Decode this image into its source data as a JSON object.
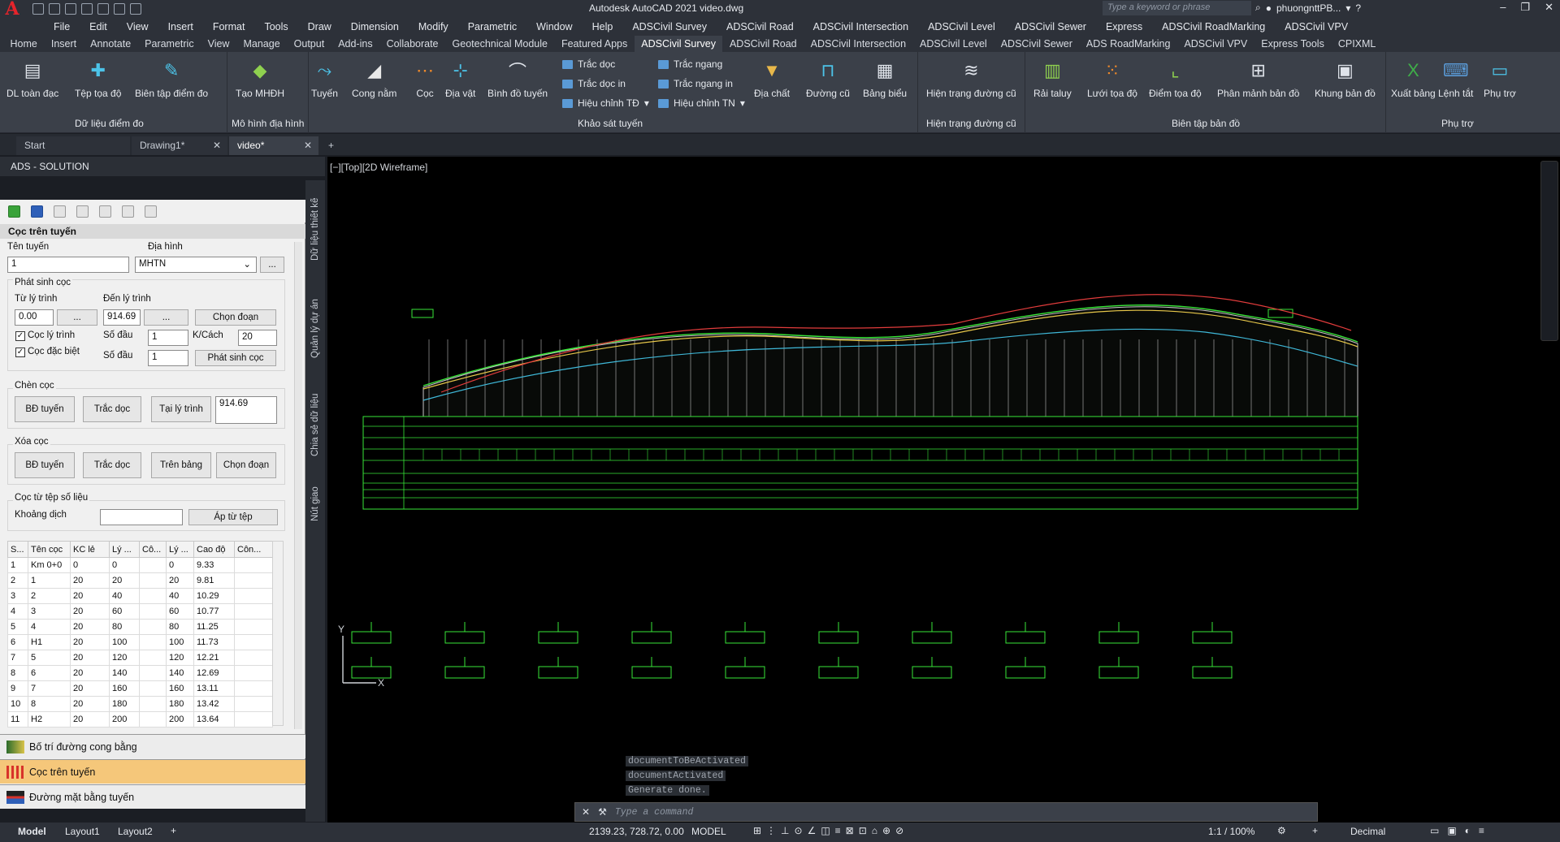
{
  "app": {
    "title": "Autodesk AutoCAD 2021  video.dwg",
    "search_placeholder": "Type a keyword or phrase",
    "user": "phuongnttPB...",
    "brand_color": "#e5242b"
  },
  "menubar": [
    "File",
    "Edit",
    "View",
    "Insert",
    "Format",
    "Tools",
    "Draw",
    "Dimension",
    "Modify",
    "Parametric",
    "Window",
    "Help",
    "ADSCivil Survey",
    "ADSCivil Road",
    "ADSCivil Intersection",
    "ADSCivil Level",
    "ADSCivil Sewer",
    "Express",
    "ADSCivil RoadMarking",
    "ADSCivil VPV"
  ],
  "ribbon_tabs": [
    "Home",
    "Insert",
    "Annotate",
    "Parametric",
    "View",
    "Manage",
    "Output",
    "Add-ins",
    "Collaborate",
    "Geotechnical Module",
    "Featured Apps",
    "ADSCivil Survey",
    "ADSCivil Road",
    "ADSCivil Intersection",
    "ADSCivil Level",
    "ADSCivil Sewer",
    "ADS RoadMarking",
    "ADSCivil VPV",
    "Express Tools",
    "CPIXML"
  ],
  "ribbon_active_tab": "ADSCivil Survey",
  "ribbon": {
    "panels": [
      "Dữ liệu điểm đo",
      "Mô hình địa hình",
      "Khảo sát tuyến",
      "Hiện trạng đường cũ",
      "Biên tập bản đồ",
      "Phụ trợ"
    ],
    "buttons": [
      "DL toàn đạc",
      "Tệp tọa độ",
      "Biên tập điểm đo",
      "Tạo MHĐH",
      "Tuyến",
      "Cong nằm",
      "Cọc",
      "Địa vật",
      "Bình đồ tuyến",
      "Địa chất",
      "Đường cũ",
      "Bảng biểu",
      "Hiện trạng đường cũ",
      "Rải taluy",
      "Lưới tọa độ",
      "Điểm tọa độ",
      "Phân mảnh bản đồ",
      "Khung bản đồ",
      "Xuất bảng",
      "Lệnh tắt",
      "Phụ trợ"
    ],
    "small_buttons": [
      "Trắc dọc",
      "Trắc dọc in",
      "Hiệu chỉnh TĐ",
      "Trắc ngang",
      "Trắc ngang in",
      "Hiệu chỉnh TN"
    ]
  },
  "doc_tabs": [
    "Start",
    "Drawing1*",
    "video*"
  ],
  "side_panel": {
    "title": "ADS - SOLUTION",
    "vertical_tabs": [
      "Dữ liệu thiết kế",
      "Quản lý dự án",
      "Chia sẻ dữ liệu",
      "Nút giao"
    ],
    "header": "Cọc trên tuyến",
    "labels": {
      "route_name": "Tên tuyến",
      "terrain": "Địa hình",
      "generate_section": "Phát sinh cọc",
      "from_station": "Từ lý trình",
      "to_station": "Đến lý trình",
      "pick_segment": "Chọn đoạn",
      "station_stake": "Cọc lý trình",
      "special_stake": "Cọc đặc biệt",
      "start_no": "Số đầu",
      "k_spacing": "K/Cách",
      "generate_btn": "Phát sinh cọc",
      "insert_section": "Chèn cọc",
      "bd_route": "BĐ tuyến",
      "profile": "Trắc dọc",
      "at_station": "Tại lý trình",
      "delete_section": "Xóa cọc",
      "on_table": "Trên bảng",
      "from_file_section": "Cọc từ tệp số liệu",
      "offset": "Khoảng dịch",
      "apply_file": "Áp từ tệp",
      "ellipsis": "..."
    },
    "values": {
      "route_name": "1",
      "terrain": "MHTN",
      "from_station": "0.00",
      "to_station": "914.69",
      "start_no_1": "1",
      "k_spacing": "20",
      "start_no_2": "1",
      "at_station": "914.69",
      "offset": ""
    },
    "checkboxes": {
      "station_stake": true,
      "special_stake": true
    },
    "table": {
      "headers": [
        "S...",
        "Tên cọc",
        "KC lẻ",
        "Lý ...",
        "Cô...",
        "Lý ...",
        "Cao độ",
        "Côn..."
      ],
      "rows": [
        [
          "1",
          "Km 0+0",
          "0",
          "0",
          "",
          "0",
          "9.33",
          ""
        ],
        [
          "2",
          "1",
          "20",
          "20",
          "",
          "20",
          "9.81",
          ""
        ],
        [
          "3",
          "2",
          "20",
          "40",
          "",
          "40",
          "10.29",
          ""
        ],
        [
          "4",
          "3",
          "20",
          "60",
          "",
          "60",
          "10.77",
          ""
        ],
        [
          "5",
          "4",
          "20",
          "80",
          "",
          "80",
          "11.25",
          ""
        ],
        [
          "6",
          "H1",
          "20",
          "100",
          "",
          "100",
          "11.73",
          ""
        ],
        [
          "7",
          "5",
          "20",
          "120",
          "",
          "120",
          "12.21",
          ""
        ],
        [
          "8",
          "6",
          "20",
          "140",
          "",
          "140",
          "12.69",
          ""
        ],
        [
          "9",
          "7",
          "20",
          "160",
          "",
          "160",
          "13.11",
          ""
        ],
        [
          "10",
          "8",
          "20",
          "180",
          "",
          "180",
          "13.42",
          ""
        ],
        [
          "11",
          "H2",
          "20",
          "200",
          "",
          "200",
          "13.64",
          ""
        ]
      ]
    },
    "accordion": [
      "Bố trí đường cong bằng",
      "Cọc trên tuyến",
      "Đường mặt bằng tuyến"
    ],
    "accordion_active": "Cọc trên tuyến"
  },
  "viewport": {
    "label": "[−][Top][2D Wireframe]",
    "ucs_y": "Y",
    "ucs_x": "X"
  },
  "command": {
    "history": [
      "documentToBeActivated",
      "documentActivated",
      "Generate done."
    ],
    "placeholder": "Type a command"
  },
  "status": {
    "layout_tabs": [
      "Model",
      "Layout1",
      "Layout2"
    ],
    "coords": "2139.23, 728.72, 0.00",
    "space": "MODEL",
    "scale": "1:1 / 100%",
    "units": "Decimal"
  }
}
